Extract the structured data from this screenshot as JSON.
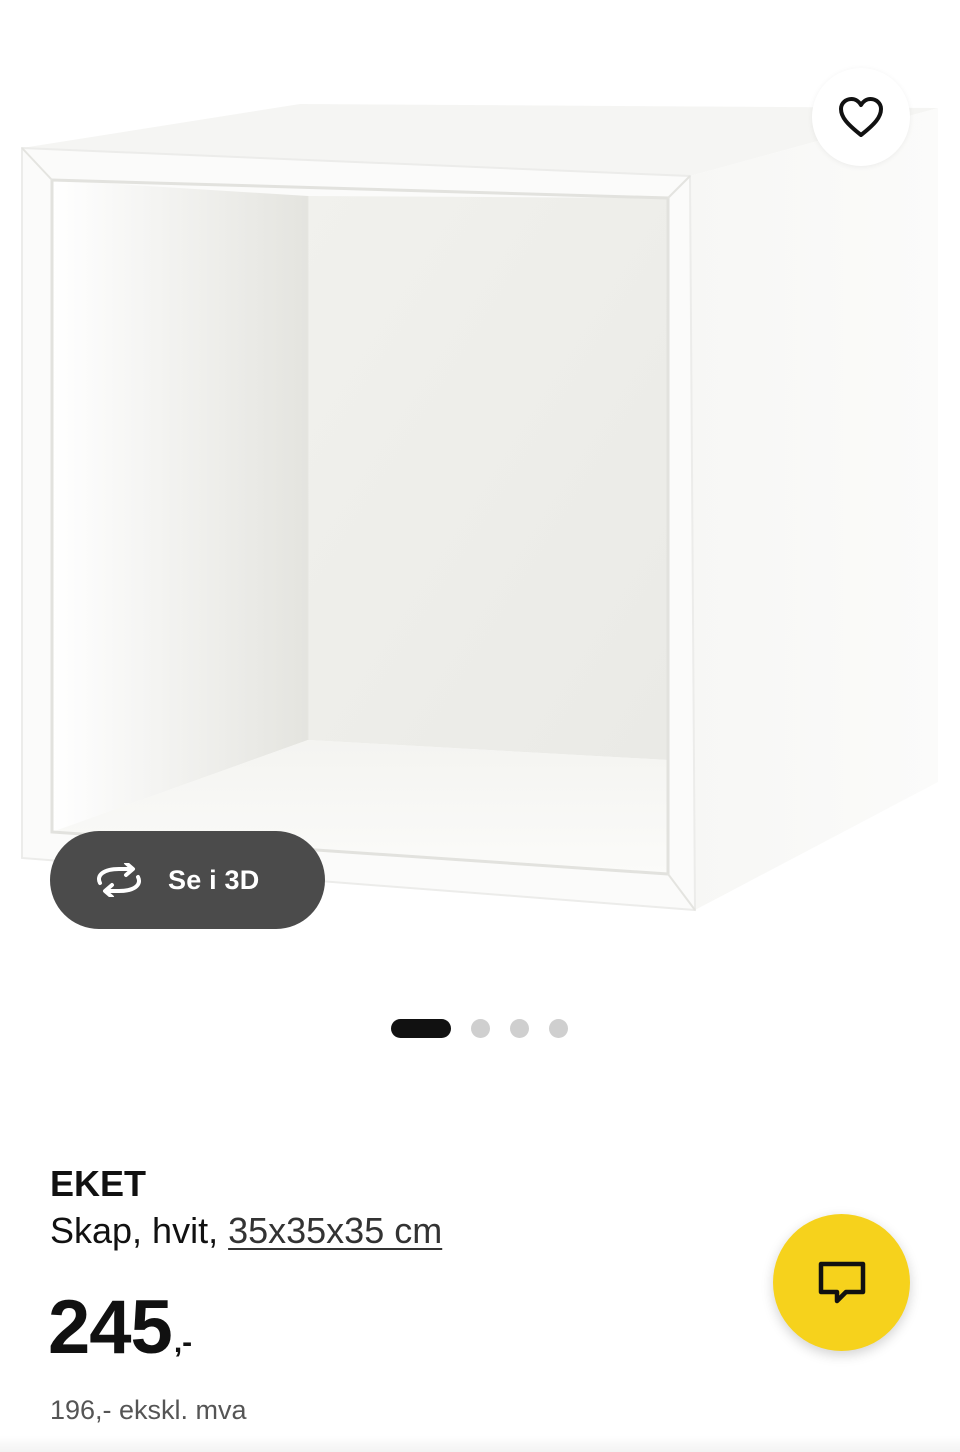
{
  "gallery": {
    "image_alt": "EKET skap, hvit",
    "favorite_icon": "heart-outline-icon",
    "view_3d_icon": "rotate-3d-icon",
    "view_3d_label": "Se i 3D",
    "slides_total": 4,
    "active_slide": 1
  },
  "product": {
    "name": "EKET",
    "description_prefix": "Skap, hvit, ",
    "size_link": "35x35x35 cm",
    "price_amount": "245",
    "price_suffix": ",-",
    "price_ex_vat": "196,- ekskl. mva"
  },
  "chat": {
    "icon": "chat-bubble-icon"
  },
  "colors": {
    "accent_yellow": "#f6d21c",
    "dark_pill": "#4b4b4b",
    "text": "#111111",
    "dot_inactive": "#cfcfcf"
  }
}
